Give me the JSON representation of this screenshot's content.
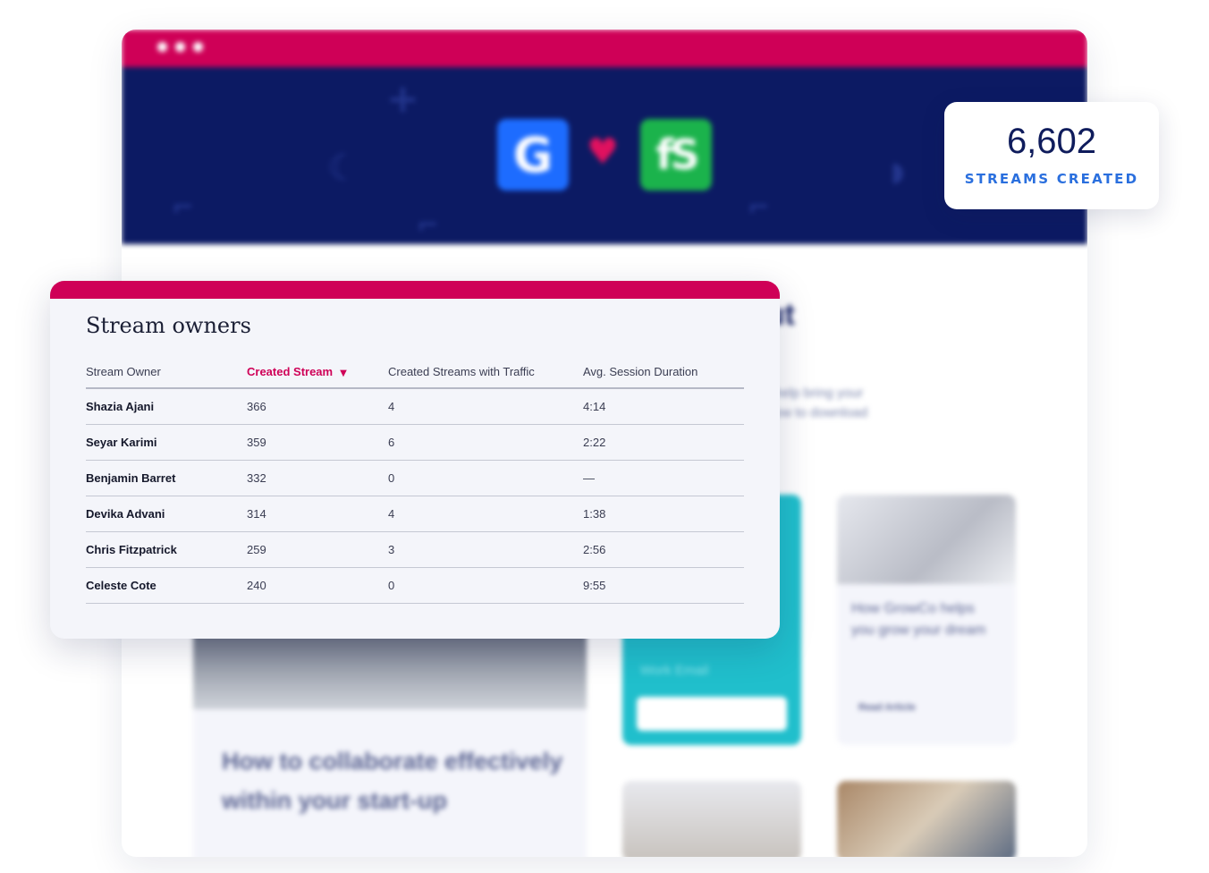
{
  "window": {
    "dots": [
      "dot",
      "dot",
      "dot"
    ],
    "hero": {
      "heart_icon": "heart-icon",
      "logo_left_icon": "g-logo-icon",
      "logo_right_icon": "fs-logo-icon"
    }
  },
  "background": {
    "heading": "out",
    "sub_line_1": "help bring your",
    "sub_line_2": "ow to download",
    "card_big_title_1": "How to collaborate effectively",
    "card_big_title_2": "within your start-up",
    "form_label": "Work Email",
    "card_small_title_1": "How GrowCo helps",
    "card_small_title_2": "you grow your dream",
    "card_small_link": "Read Article"
  },
  "stats": {
    "value": "6,602",
    "label": "STREAMS CREATED"
  },
  "panel": {
    "title": "Stream owners",
    "columns": {
      "owner": "Stream Owner",
      "created": "Created Stream",
      "traffic": "Created Streams with Traffic",
      "duration": "Avg. Session Duration"
    },
    "sort_icon": "sort-down-icon",
    "rows": [
      {
        "name": "Shazia Ajani",
        "created": "366",
        "traffic": "4",
        "duration": "4:14"
      },
      {
        "name": "Seyar Karimi",
        "created": "359",
        "traffic": "6",
        "duration": "2:22"
      },
      {
        "name": "Benjamin Barret",
        "created": "332",
        "traffic": "0",
        "duration": "—"
      },
      {
        "name": "Devika Advani",
        "created": "314",
        "traffic": "4",
        "duration": "1:38"
      },
      {
        "name": "Chris Fitzpatrick",
        "created": "259",
        "traffic": "3",
        "duration": "2:56"
      },
      {
        "name": "Celeste Cote",
        "created": "240",
        "traffic": "0",
        "duration": "9:55"
      }
    ]
  },
  "colors": {
    "brand_pink": "#cf0057",
    "hero_navy": "#0c1a63",
    "accent_blue": "#2a6fde"
  }
}
